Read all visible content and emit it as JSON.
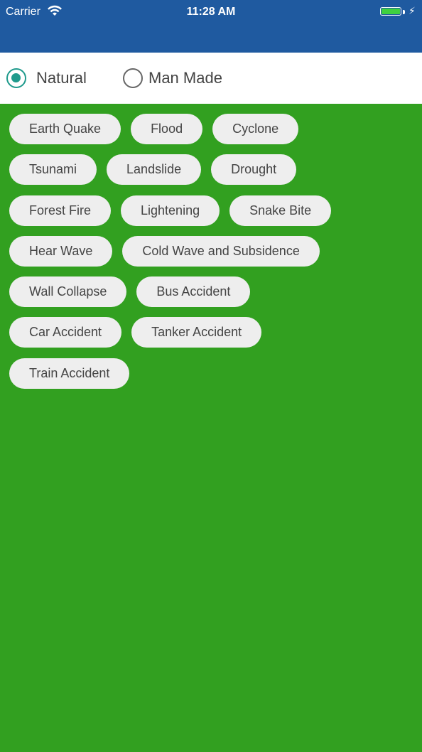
{
  "status_bar": {
    "carrier": "Carrier",
    "time": "11:28 AM",
    "wifi_icon": "wifi-icon",
    "battery_icon": "battery-icon",
    "charging_icon": "bolt-icon",
    "battery_color": "#3fd13f"
  },
  "colors": {
    "header": "#1f5aa0",
    "background": "#32a020",
    "radio_accent": "#1f9a8c",
    "chip_bg": "#eeeeee"
  },
  "radio": {
    "options": [
      {
        "label": "Natural",
        "selected": true
      },
      {
        "label": "Man Made",
        "selected": false
      }
    ]
  },
  "chips": [
    [
      "Earth Quake",
      "Flood",
      "Cyclone"
    ],
    [
      "Tsunami",
      "Landslide",
      "Drought"
    ],
    [
      "Forest Fire",
      "Lightening",
      "Snake Bite"
    ],
    [
      "Hear Wave",
      "Cold Wave and Subsidence"
    ],
    [
      "Wall Collapse",
      "Bus Accident"
    ],
    [
      "Car Accident",
      "Tanker Accident"
    ],
    [
      "Train Accident"
    ]
  ]
}
